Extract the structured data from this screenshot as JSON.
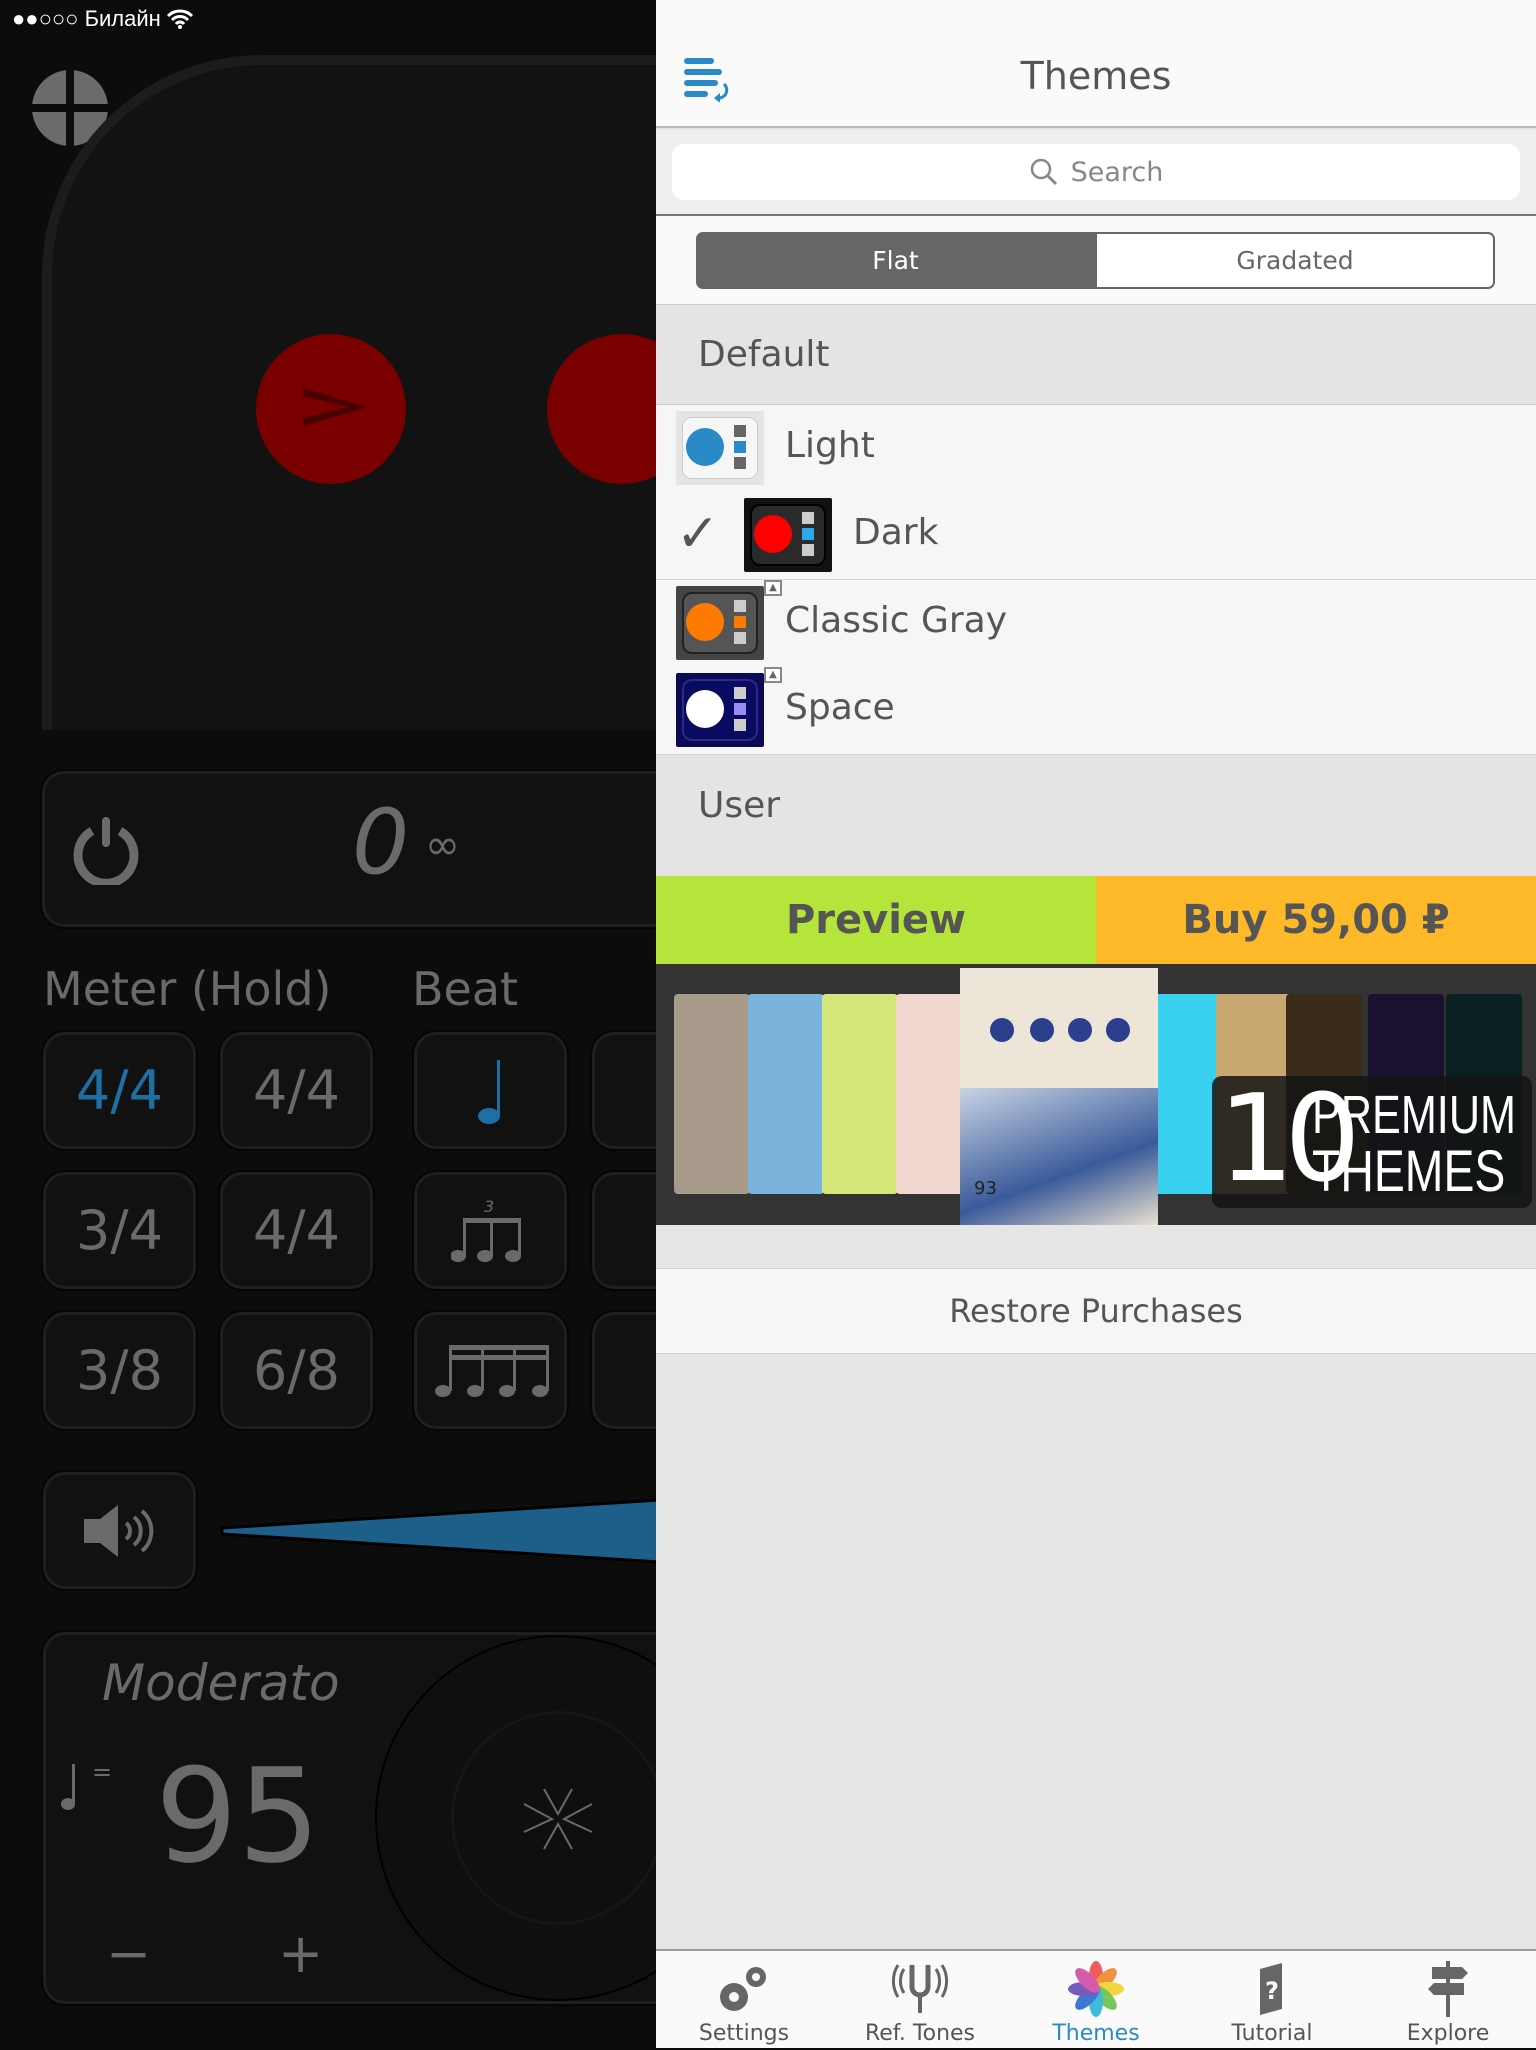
{
  "left_app": {
    "status": {
      "signal": "●●○○○",
      "carrier": "Билайн"
    },
    "counter": {
      "value": "0",
      "loop": "∞"
    },
    "meter_label": "Meter (Hold)",
    "beat_label": "Beat",
    "meters": [
      "4/4",
      "4/4",
      "3/4",
      "4/4",
      "3/8",
      "6/8"
    ],
    "selected_meter": 0,
    "tempo": {
      "name": "Moderato",
      "bpm": "95",
      "note_eq": "=",
      "minus": "−",
      "plus": "+"
    },
    "volume_level": 0.85,
    "accent_color": "#1e6fa3"
  },
  "themes_panel": {
    "title": "Themes",
    "search_placeholder": "Search",
    "segments": [
      "Flat",
      "Gradated"
    ],
    "selected_segment": "Flat",
    "sections": [
      {
        "header": "Default",
        "items": [
          {
            "name": "Light",
            "selected": false,
            "colors": {
              "bg": "#e8e8e8",
              "dot": "#2a8ac6",
              "accent": "#2a8ac6"
            }
          },
          {
            "name": "Dark",
            "selected": true,
            "colors": {
              "bg": "#111111",
              "dot": "#ff0000",
              "accent": "#29aaf0"
            }
          },
          {
            "name": "Classic Gray",
            "selected": false,
            "colors": {
              "bg": "#444444",
              "dot": "#ff7a00",
              "accent": "#ff7a00"
            }
          },
          {
            "name": "Space",
            "selected": false,
            "colors": {
              "bg": "#0a0a55",
              "dot": "#ffffff",
              "accent": "#9a8cf0"
            }
          }
        ]
      },
      {
        "header": "User",
        "items": []
      }
    ],
    "checkmark": "✓",
    "preview_label": "Preview",
    "buy_label": "Buy 59,00 ₽",
    "preview_color": "#b5e43a",
    "buy_color": "#fdb928",
    "banner": {
      "number": "10",
      "line1": "PREMIUM",
      "line2": "THEMES",
      "bpm": "93"
    },
    "restore_label": "Restore Purchases"
  },
  "tabbar": {
    "items": [
      {
        "label": "Settings",
        "icon": "gears-icon",
        "active": false
      },
      {
        "label": "Ref. Tones",
        "icon": "tuning-fork-icon",
        "active": false
      },
      {
        "label": "Themes",
        "icon": "color-flower-icon",
        "active": true
      },
      {
        "label": "Tutorial",
        "icon": "book-question-icon",
        "active": false
      },
      {
        "label": "Explore",
        "icon": "signpost-icon",
        "active": false
      }
    ],
    "active_color": "#2a8ac6"
  }
}
